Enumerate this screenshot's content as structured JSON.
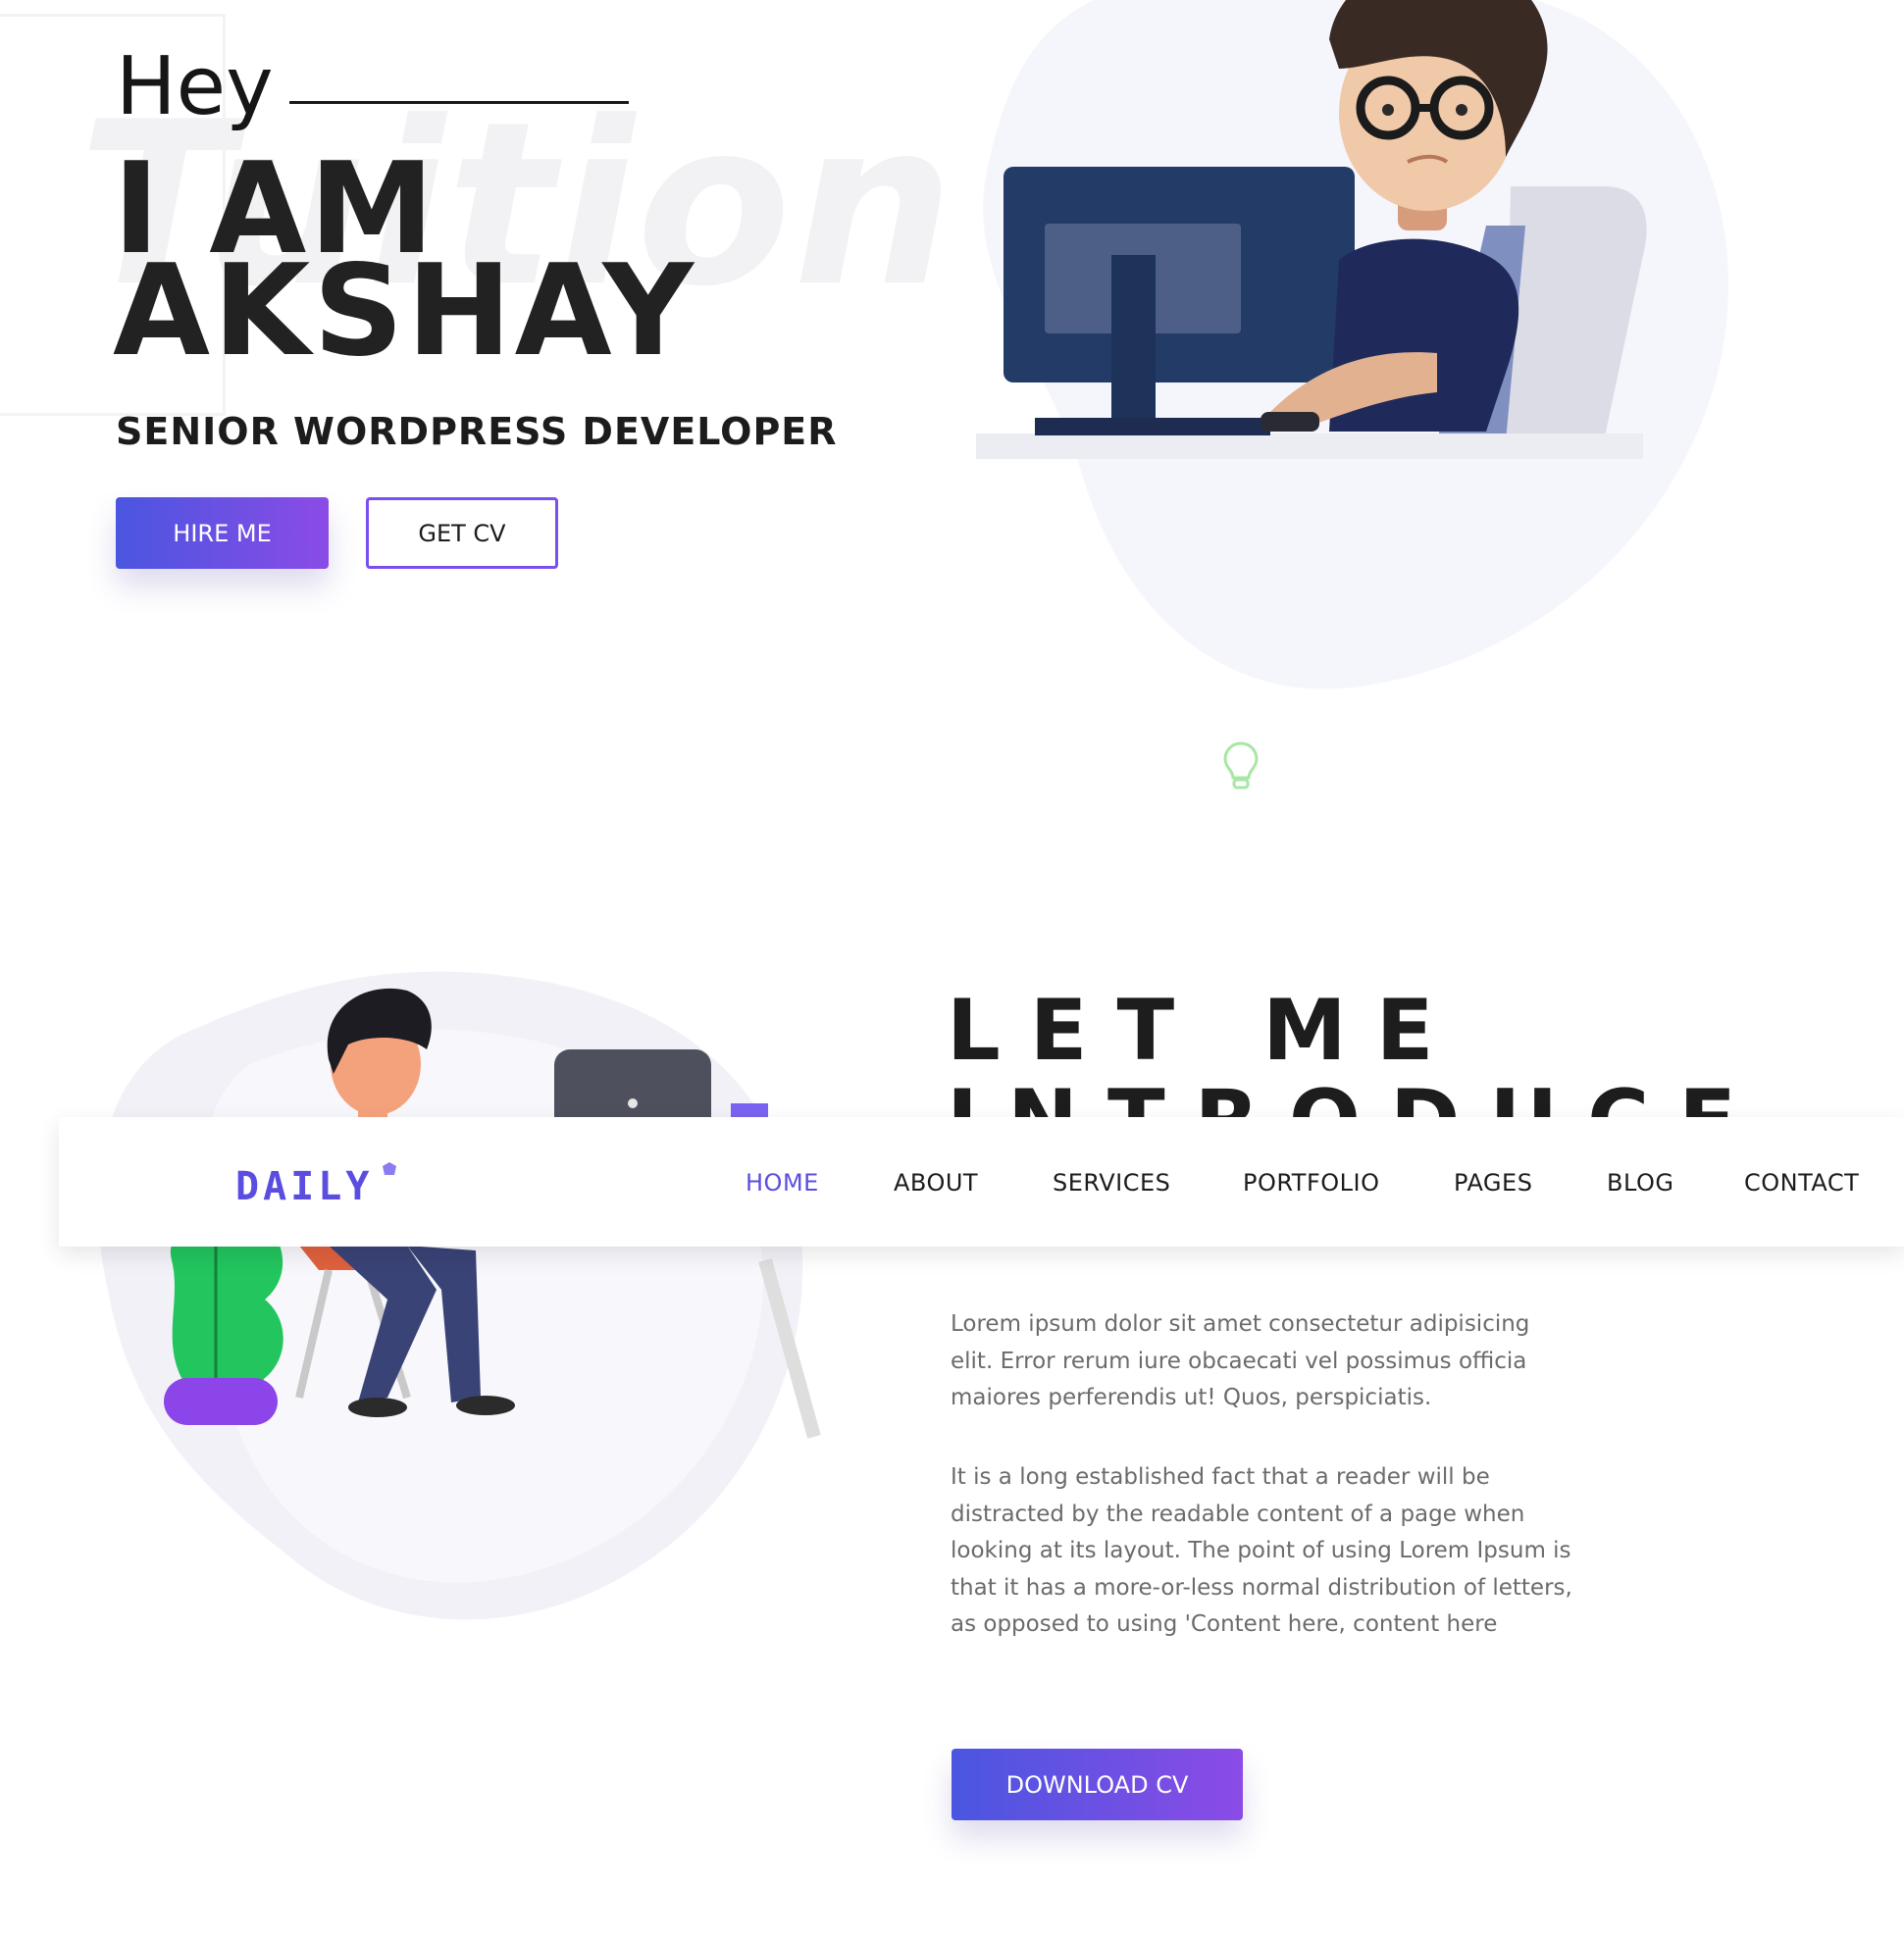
{
  "hero": {
    "greeting": "Hey",
    "name": "I AM\nAKSHAY",
    "role": "SENIOR WORDPRESS DEVELOPER",
    "watermark": "Tuition",
    "hire_label": "HIRE ME",
    "cv_label": "GET CV"
  },
  "about": {
    "title": "LET ME\nINTRODUCE",
    "paragraph1": "Lorem ipsum dolor sit amet consectetur adipisicing elit. Error rerum iure obcaecati vel possimus officia maiores perferendis ut! Quos, perspiciatis.",
    "paragraph2": "It is a long established fact that a reader will be distracted by the readable content of a page when looking at its layout. The point of using Lorem Ipsum is that it has a more-or-less normal distribution of letters, as opposed to using 'Content here, content here",
    "download_label": "DOWNLOAD CV"
  },
  "nav": {
    "logo": "DAILY",
    "items": [
      "HOME",
      "ABOUT",
      "SERVICES",
      "PORTFOLIO",
      "PAGES",
      "BLOG",
      "CONTACT"
    ],
    "active": "HOME"
  },
  "colors": {
    "accent": "#5b4de0",
    "gradient_start": "#4a56e0",
    "gradient_end": "#8b4be6",
    "blob": "#f5f5fc"
  },
  "icons": [
    "lightbulb-icon",
    "logo-dot-icon"
  ]
}
